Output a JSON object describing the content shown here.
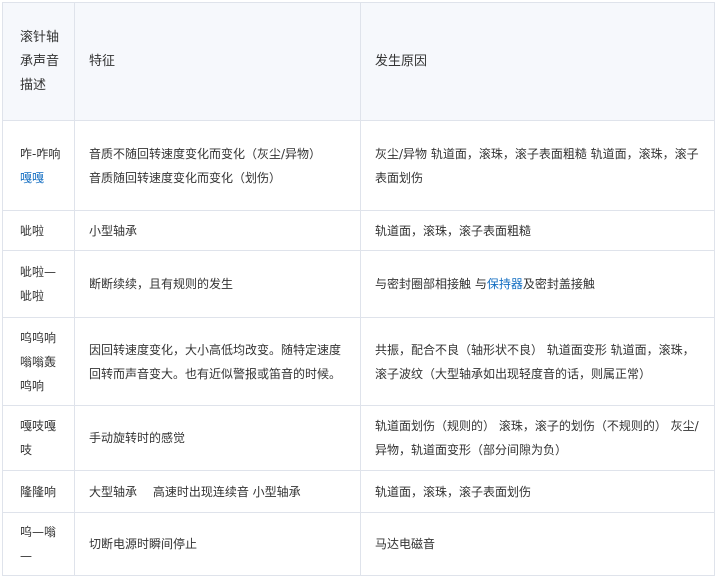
{
  "table": {
    "headers": [
      "滚针轴承声音描述",
      "特征",
      "发生原因"
    ],
    "rows": [
      {
        "sound": "咋-咋响 ",
        "sound_link": "嘎嘎",
        "feature": [
          "音质不随回转速度变化而变化（灰尘/异物）",
          "音质随回转速度变化而变化（划伤）"
        ],
        "cause_pre": "灰尘/异物 轨道面，滚珠，滚子表面粗糙 轨道面，滚珠，滚子表面划伤",
        "cause_link": "",
        "cause_post": ""
      },
      {
        "sound": "呲啦",
        "sound_link": "",
        "feature": [
          "小型轴承"
        ],
        "cause_pre": "轨道面，滚珠，滚子表面粗糙",
        "cause_link": "",
        "cause_post": ""
      },
      {
        "sound": "呲啦—呲啦",
        "sound_link": "",
        "feature": [
          "断断续续，且有规则的发生"
        ],
        "cause_pre": "与密封圈部相接触 与",
        "cause_link": "保持器",
        "cause_post": "及密封盖接触"
      },
      {
        "sound": "呜呜响嗡嗡轰鸣响",
        "sound_link": "",
        "feature": [
          "因回转速度变化，大小高低均改变。随特定速度回转而声音变大。也有近似警报或笛音的时候。"
        ],
        "cause_pre": "共振，配合不良（轴形状不良） 轨道面变形 轨道面，滚珠，滚子波纹（大型轴承如出现轻度音的话，则属正常）",
        "cause_link": "",
        "cause_post": ""
      },
      {
        "sound": "嘎吱嘎吱",
        "sound_link": "",
        "feature": [
          "手动旋转时的感觉"
        ],
        "cause_pre": "轨道面划伤（规则的） 滚珠，滚子的划伤（不规则的） 灰尘/异物，轨道面变形（部分间隙为负）",
        "cause_link": "",
        "cause_post": ""
      },
      {
        "sound": "隆隆响",
        "sound_link": "",
        "feature": [
          "大型轴承　 高速时出现连续音 小型轴承"
        ],
        "cause_pre": "轨道面，滚珠，滚子表面划伤",
        "cause_link": "",
        "cause_post": ""
      },
      {
        "sound": "呜—嗡—",
        "sound_link": "",
        "feature": [
          "切断电源时瞬间停止"
        ],
        "cause_pre": "马达电磁音",
        "cause_link": "",
        "cause_post": ""
      }
    ]
  }
}
